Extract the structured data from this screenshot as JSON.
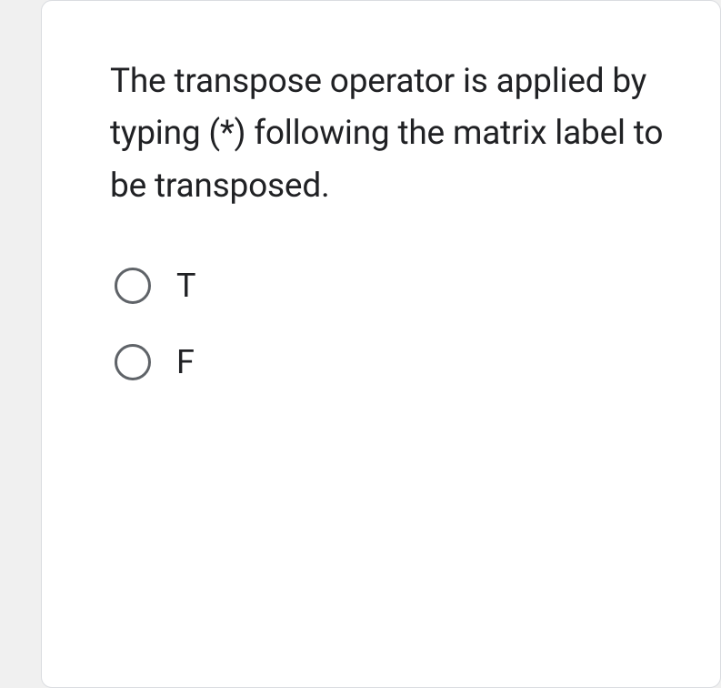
{
  "question": {
    "text": "The transpose operator is applied by typing (*) following the matrix label to be transposed."
  },
  "options": [
    {
      "label": "T"
    },
    {
      "label": "F"
    }
  ]
}
